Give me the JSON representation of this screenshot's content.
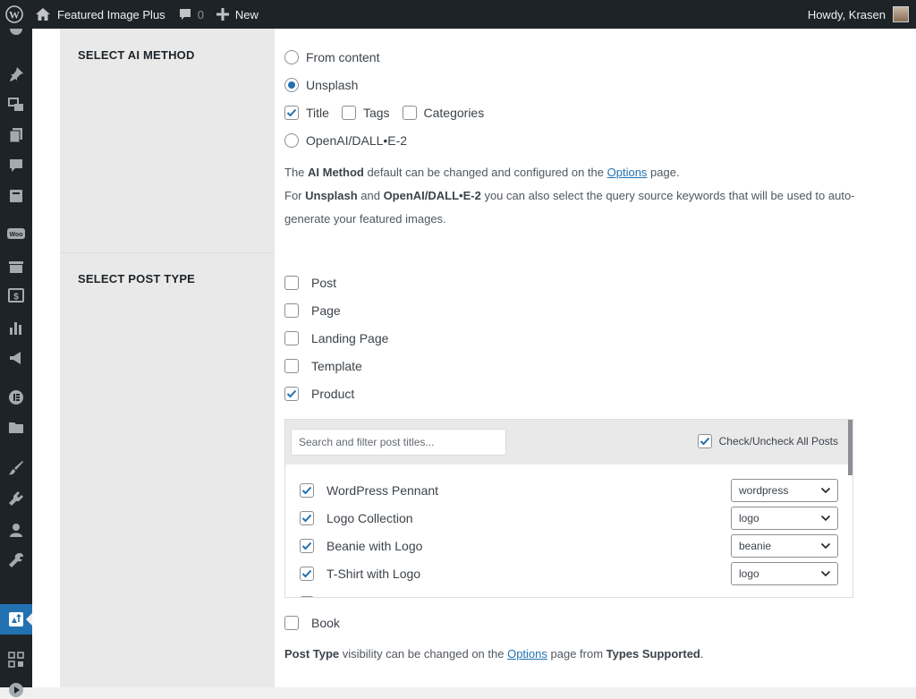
{
  "adminbar": {
    "site_name": "Featured Image Plus",
    "comments_count": "0",
    "new_label": "New",
    "greeting": "Howdy, Krasen"
  },
  "sidebar": {
    "icons": [
      "dashboard-icon",
      "pin-icon",
      "media-icon",
      "pages-icon",
      "comments-icon",
      "book-icon",
      "woo-icon",
      "archive-icon",
      "dollar-icon",
      "stats-icon",
      "megaphone-icon",
      "elementor-icon",
      "folder-icon",
      "brush-icon",
      "plugin-icon",
      "user-icon",
      "wrench-icon",
      "image-plus-icon",
      "grid-icon",
      "play-icon"
    ]
  },
  "ai_method": {
    "title": "SELECT AI METHOD",
    "options": [
      {
        "label": "From content",
        "selected": false
      },
      {
        "label": "Unsplash",
        "selected": true
      },
      {
        "label": "OpenAI/DALL•E-2",
        "selected": false
      }
    ],
    "keywords": [
      {
        "label": "Title",
        "checked": true
      },
      {
        "label": "Tags",
        "checked": false
      },
      {
        "label": "Categories",
        "checked": false
      }
    ],
    "note1_pre": "The ",
    "note1_b": "AI Method",
    "note1_mid": " default can be changed and configured on the ",
    "note1_link": "Options",
    "note1_post": " page.",
    "note2_pre": "For ",
    "note2_b1": "Unsplash",
    "note2_mid": " and ",
    "note2_b2": "OpenAI/DALL•E-2",
    "note2_post": " you can also select the query source keywords that will be used to auto-",
    "note3": "generate your featured images."
  },
  "post_type": {
    "title": "SELECT POST TYPE",
    "types": [
      {
        "label": "Post",
        "checked": false
      },
      {
        "label": "Page",
        "checked": false
      },
      {
        "label": "Landing Page",
        "checked": false
      },
      {
        "label": "Template",
        "checked": false
      },
      {
        "label": "Product",
        "checked": true
      }
    ],
    "search_placeholder": "Search and filter post titles...",
    "check_all_label": "Check/Uncheck All Posts",
    "posts": [
      {
        "title": "WordPress Pennant",
        "keyword": "wordpress"
      },
      {
        "title": "Logo Collection",
        "keyword": "logo"
      },
      {
        "title": "Beanie with Logo",
        "keyword": "beanie"
      },
      {
        "title": "T-Shirt with Logo",
        "keyword": "logo"
      }
    ],
    "book_label": "Book",
    "note_b1": "Post Type",
    "note_mid": " visibility can be changed on the ",
    "note_link": "Options",
    "note_mid2": " page from ",
    "note_b2": "Types Supported",
    "note_end": "."
  },
  "colors": {
    "accent": "#2271b1",
    "adminbar": "#1d2327"
  }
}
